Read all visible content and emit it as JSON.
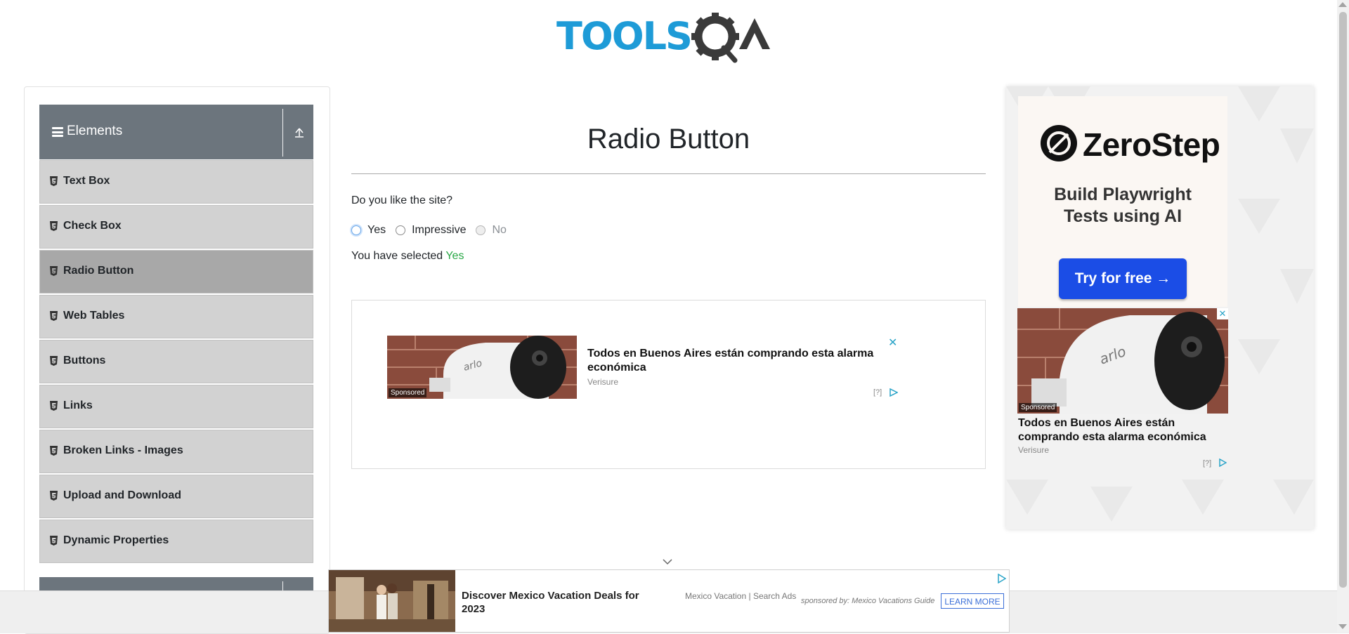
{
  "header": {
    "logo_text": "TOOLSQA"
  },
  "sidebar": {
    "group_title": "Elements",
    "items": [
      {
        "label": "Text Box"
      },
      {
        "label": "Check Box"
      },
      {
        "label": "Radio Button",
        "active": true
      },
      {
        "label": "Web Tables"
      },
      {
        "label": "Buttons"
      },
      {
        "label": "Links"
      },
      {
        "label": "Broken Links - Images"
      },
      {
        "label": "Upload and Download"
      },
      {
        "label": "Dynamic Properties"
      }
    ]
  },
  "main": {
    "title": "Radio Button",
    "question": "Do you like the site?",
    "options": [
      {
        "label": "Yes",
        "checked": true,
        "disabled": false
      },
      {
        "label": "Impressive",
        "checked": false,
        "disabled": false
      },
      {
        "label": "No",
        "checked": false,
        "disabled": true
      }
    ],
    "result_prefix": "You have selected",
    "result_value": "Yes",
    "result_color": "#28a745"
  },
  "inline_ad": {
    "sponsored": "Sponsored",
    "headline": "Todos en Buenos Aires están comprando esta alarma económica",
    "brand": "Verisure",
    "info": "[?]",
    "close": "✕"
  },
  "right_ad": {
    "brand": "ZeroStep",
    "tagline_line1": "Build Playwright",
    "tagline_line2": "Tests using AI",
    "cta": "Try for free →",
    "sponsored": "Sponsored",
    "headline": "Todos en Buenos Aires están comprando esta alarma económica",
    "ad_brand": "Verisure",
    "info": "[?]",
    "close": "✕"
  },
  "bottom_ad": {
    "title": "Discover Mexico Vacation Deals for 2023",
    "subtitle": "Mexico Vacation | Search Ads",
    "sponsor": "sponsored by: Mexico Vacations Guide",
    "button": "LEARN MORE"
  },
  "colors": {
    "sidebar_header": "#6c757d",
    "menu_item": "#d2d2d2",
    "menu_item_active": "#a8a8a8",
    "logo_blue": "#1e9bd7",
    "logo_dark": "#3a3a3a",
    "cta_blue": "#1b4de6"
  }
}
